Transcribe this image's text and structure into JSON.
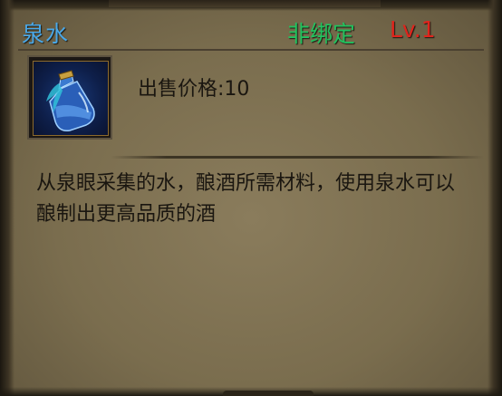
{
  "item": {
    "name": "泉水",
    "bind_state": "非绑定",
    "level": "Lv.1",
    "price_label": "出售价格:10",
    "description": "从泉眼采集的水，酿酒所需材料，使用泉水可以酿制出更高品质的酒",
    "icon": "potion-bottle-icon"
  },
  "colors": {
    "name": "#4aa8e8",
    "bind_state": "#22c25e",
    "level": "#e0241c",
    "text": "#1a1610",
    "panel": "#7a6d4e"
  }
}
